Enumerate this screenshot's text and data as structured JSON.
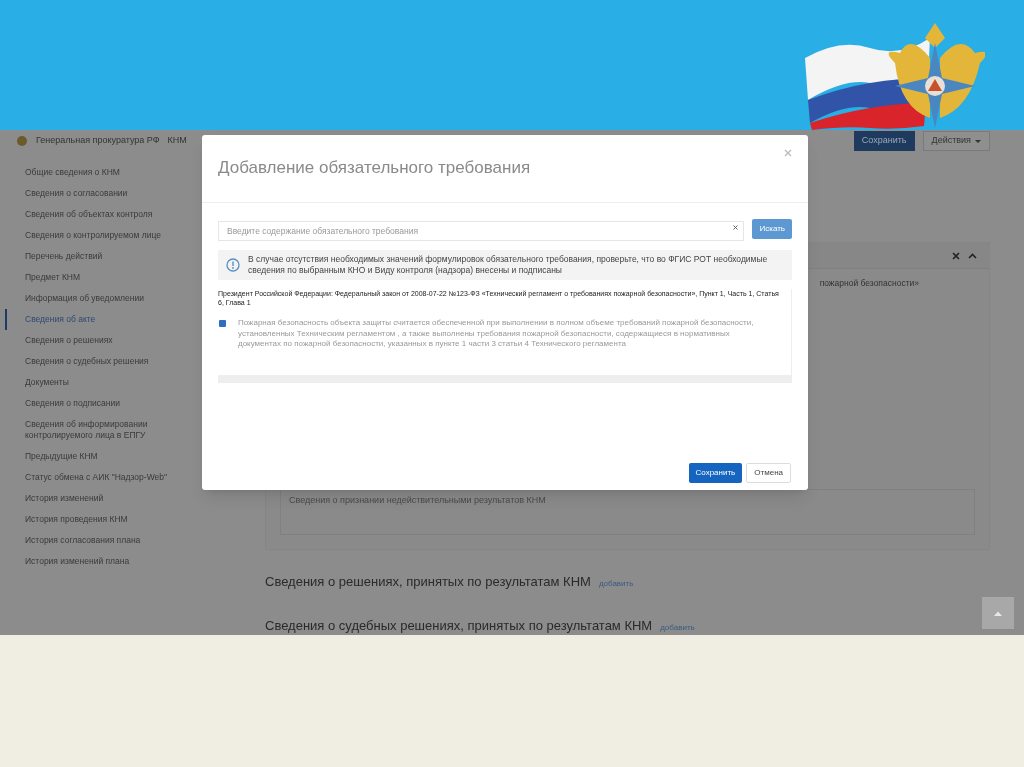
{
  "header": {
    "org": "Генеральная прокуратура РФ",
    "section": "КНМ"
  },
  "actions": [
    {
      "label": "Сохранить",
      "kind": "primary"
    },
    {
      "label": "Действия",
      "kind": "dropdown"
    }
  ],
  "sidebar": {
    "items": [
      {
        "label": "Общие сведения о КНМ",
        "selected": false
      },
      {
        "label": "Сведения о согласовании",
        "selected": false
      },
      {
        "label": "Сведения об объектах контроля",
        "selected": false
      },
      {
        "label": "Сведения о контролируемом лице",
        "selected": false
      },
      {
        "label": "Перечень действий",
        "selected": false
      },
      {
        "label": "Предмет КНМ",
        "selected": false
      },
      {
        "label": "Информация об уведомлении",
        "selected": false
      },
      {
        "label": "Сведения об акте",
        "selected": true
      },
      {
        "label": "Сведения о решениях",
        "selected": false
      },
      {
        "label": "Сведения о судебных решения",
        "selected": false
      },
      {
        "label": "Документы",
        "selected": false
      },
      {
        "label": "Сведения о подписании",
        "selected": false
      },
      {
        "label": "Сведения об информировании контролируемого лица в ЕПГУ",
        "selected": false
      },
      {
        "label": "Предыдущие КНМ",
        "selected": false
      },
      {
        "label": "Статус обмена с АИК \"Надзор-Web\"",
        "selected": false
      },
      {
        "label": "История изменений",
        "selected": false
      },
      {
        "label": "История проведения КНМ",
        "selected": false
      },
      {
        "label": "История согласования плана",
        "selected": false
      },
      {
        "label": "История изменений плана",
        "selected": false
      }
    ]
  },
  "content": {
    "panel_text": "пожарной безопасности»",
    "textarea_placeholder": "Сведения о признании недействительными результатов КНМ",
    "sections": [
      {
        "title": "Сведения о решениях, принятых по результатам КНМ",
        "link": "добавить"
      },
      {
        "title": "Сведения о судебных решениях, принятых по результатам КНМ",
        "link": "добавить"
      }
    ]
  },
  "modal": {
    "title": "Добавление обязательного требования",
    "search": {
      "placeholder": "Введите содержание обязательного требования"
    },
    "search_button": "Искать",
    "info": "В случае отсутствия необходимых значений формулировок обязательного требования, проверьте, что во ФГИС РОТ необходимые сведения по выбранным КНО и Виду контроля (надзора) внесены и подписаны",
    "requirements": [
      {
        "source": "Президент Российской Федерации: Федеральный закон от 2008-07-22 №123-ФЗ «Технический регламент о требованиях пожарной безопасности», Пункт 1, Часть 1, Статья 6, Глава 1",
        "items": [
          {
            "text": "Пожарная безопасность объекта защиты считается обеспеченной при выполнении в полном объеме требований пожарной безопасности, установленных Техническим регламентом , а также выполнены требования пожарной безопасности, содержащиеся в нормативных документах по пожарной безопасности, указанных в пункте 1 части 3 статьи 4 Технического регламента",
            "checked": true
          }
        ]
      }
    ],
    "buttons": [
      {
        "label": "Сохранить",
        "kind": "primary"
      },
      {
        "label": "Отмена",
        "kind": "secondary"
      }
    ]
  }
}
